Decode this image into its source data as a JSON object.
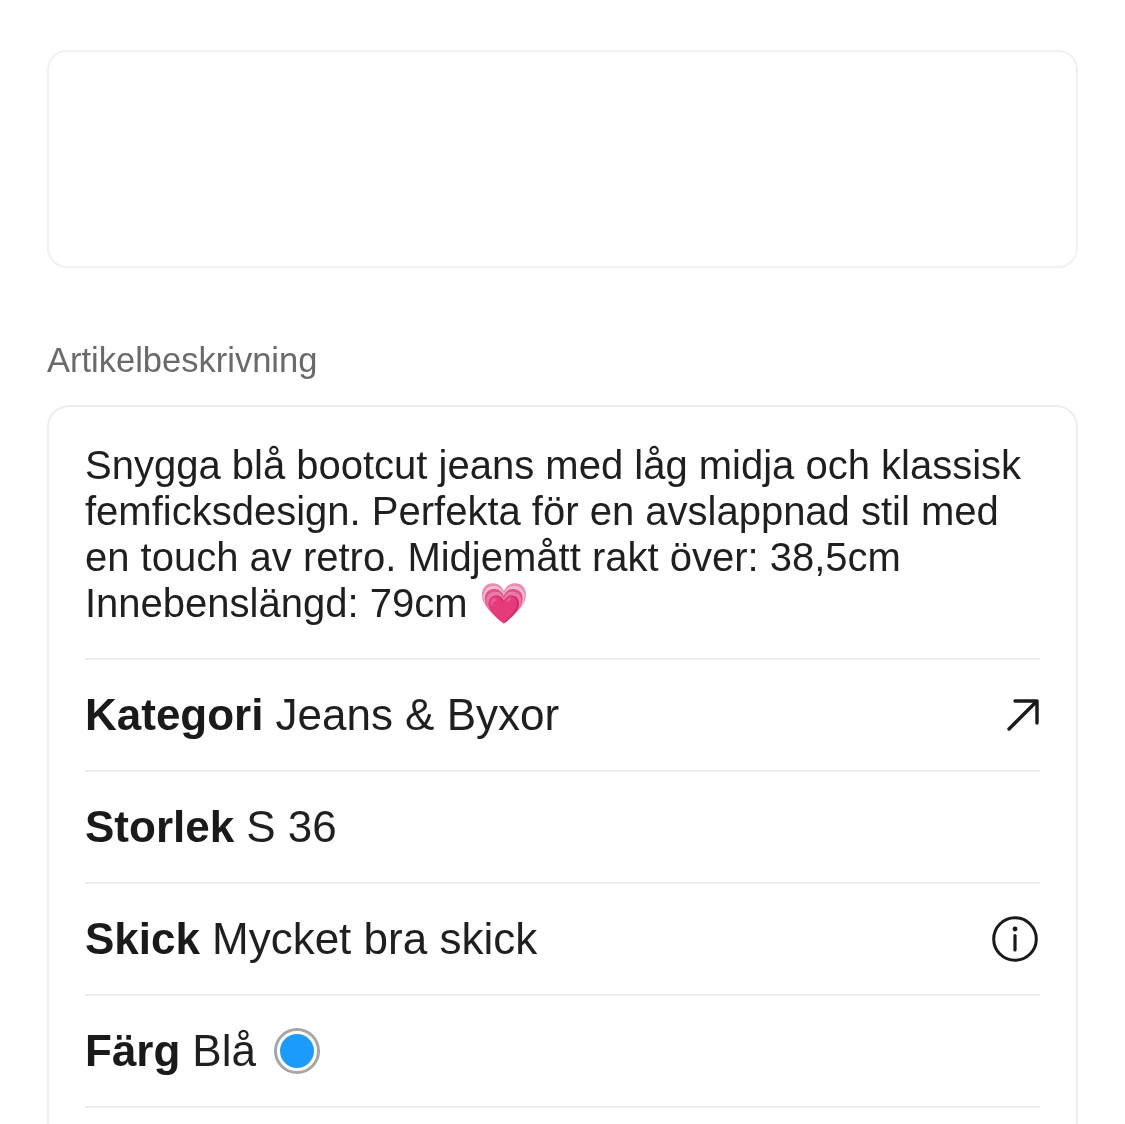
{
  "section_title": "Artikelbeskrivning",
  "description": "Snygga blå bootcut jeans med låg midja och klassisk femficksdesign. Perfekta för en avslappnad stil med en touch av retro. Midjemått rakt över: 38,5cm Innebenslängd: 79cm 💗",
  "details": [
    {
      "kind": "link",
      "label": "Kategori",
      "value": "Jeans & Byxor"
    },
    {
      "kind": "plain",
      "label": "Storlek",
      "value": "S 36"
    },
    {
      "kind": "info",
      "label": "Skick",
      "value": "Mycket bra skick"
    },
    {
      "kind": "color",
      "label": "Färg",
      "value": "Blå",
      "color": "#1b9cfc"
    }
  ]
}
